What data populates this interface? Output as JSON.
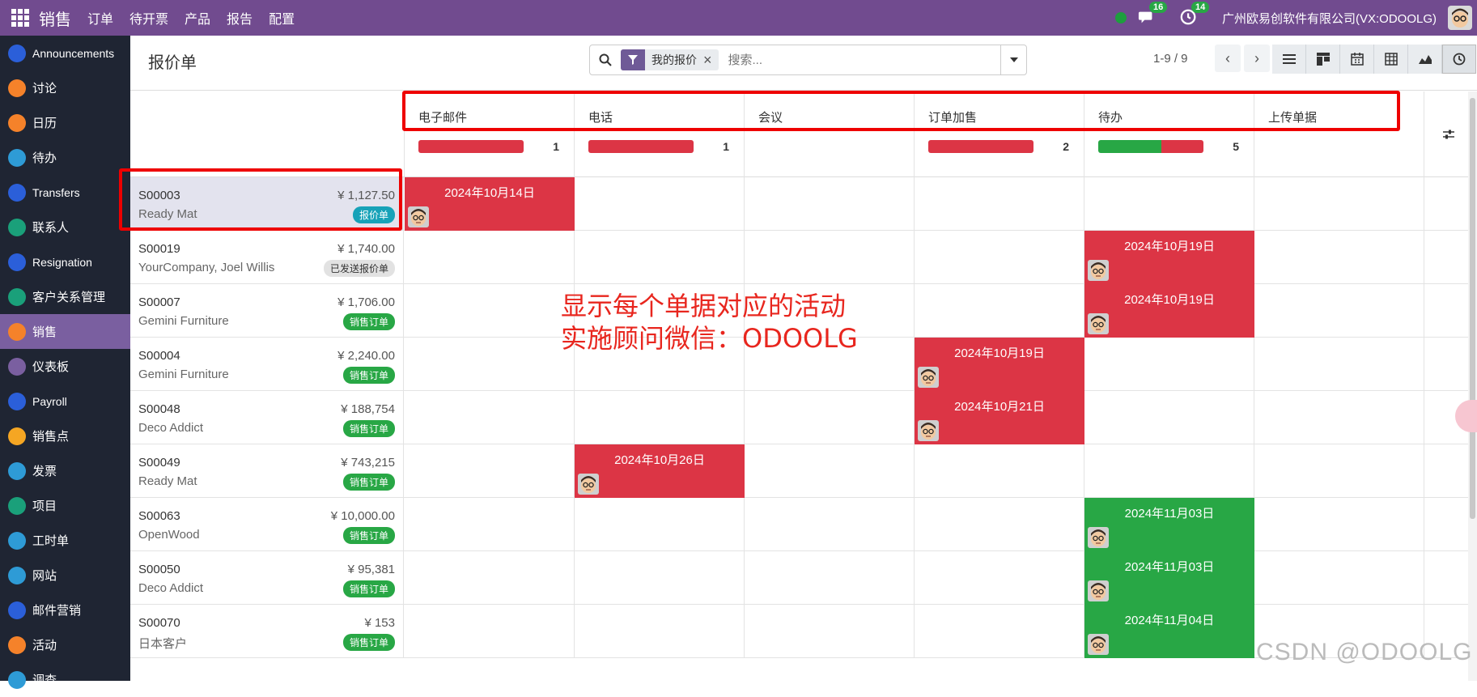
{
  "topbar": {
    "app_name": "销售",
    "menu": [
      "订单",
      "待开票",
      "产品",
      "报告",
      "配置"
    ],
    "messages_count": "16",
    "activities_count": "14",
    "company": "广州欧易创软件有限公司(VX:ODOOLG)"
  },
  "sidebar": {
    "items": [
      {
        "label": "Announcements",
        "icon": "megaphone-icon",
        "color": "#2b5fd9"
      },
      {
        "label": "讨论",
        "icon": "chat-bubble-icon",
        "color": "#f5822a"
      },
      {
        "label": "日历",
        "icon": "calendar-icon",
        "color": "#f5822a"
      },
      {
        "label": "待办",
        "icon": "pen-icon",
        "color": "#2e9bd6"
      },
      {
        "label": "Transfers",
        "icon": "transfer-icon",
        "color": "#2b5fd9"
      },
      {
        "label": "联系人",
        "icon": "contact-card-icon",
        "color": "#1aa07a"
      },
      {
        "label": "Resignation",
        "icon": "resignation-icon",
        "color": "#2b5fd9"
      },
      {
        "label": "客户关系管理",
        "icon": "crm-diamond-icon",
        "color": "#1aa07a"
      },
      {
        "label": "销售",
        "icon": "sales-chart-icon",
        "color": "#f5822a"
      },
      {
        "label": "仪表板",
        "icon": "dashboard-icon",
        "color": "#7a5fa0"
      },
      {
        "label": "Payroll",
        "icon": "payroll-icon",
        "color": "#2b5fd9"
      },
      {
        "label": "销售点",
        "icon": "pos-icon",
        "color": "#f5a623"
      },
      {
        "label": "发票",
        "icon": "invoice-icon",
        "color": "#2e9bd6"
      },
      {
        "label": "项目",
        "icon": "project-check-icon",
        "color": "#1aa07a"
      },
      {
        "label": "工时单",
        "icon": "timesheet-clock-icon",
        "color": "#2e9bd6"
      },
      {
        "label": "网站",
        "icon": "website-globe-icon",
        "color": "#2e9bd6"
      },
      {
        "label": "邮件营销",
        "icon": "email-marketing-icon",
        "color": "#2b5fd9"
      },
      {
        "label": "活动",
        "icon": "event-icon",
        "color": "#f5822a"
      },
      {
        "label": "调查",
        "icon": "survey-icon",
        "color": "#2e9bd6"
      }
    ]
  },
  "control": {
    "title": "报价单",
    "facet": "我的报价",
    "search_placeholder": "搜索...",
    "pager": "1-9 / 9"
  },
  "columns": [
    {
      "title": "电子邮件",
      "count": "1",
      "done_ratio": 0
    },
    {
      "title": "电话",
      "count": "1",
      "done_ratio": 0
    },
    {
      "title": "会议",
      "count": "",
      "done_ratio": null
    },
    {
      "title": "订单加售",
      "count": "2",
      "done_ratio": 0
    },
    {
      "title": "待办",
      "count": "5",
      "done_ratio": 0.6
    },
    {
      "title": "上传单据",
      "count": "",
      "done_ratio": null
    }
  ],
  "rows": [
    {
      "name": "S00003",
      "partner": "Ready Mat",
      "amount": "¥ 1,127.50",
      "status": "报价单",
      "status_type": "quote",
      "activity_col": 0,
      "activity_date": "2024年10月14日",
      "activity_color": "red"
    },
    {
      "name": "S00019",
      "partner": "YourCompany, Joel Willis",
      "amount": "¥ 1,740.00",
      "status": "已发送报价单",
      "status_type": "sent",
      "activity_col": 4,
      "activity_date": "2024年10月19日",
      "activity_color": "red"
    },
    {
      "name": "S00007",
      "partner": "Gemini Furniture",
      "amount": "¥ 1,706.00",
      "status": "销售订单",
      "status_type": "order",
      "activity_col": 4,
      "activity_date": "2024年10月19日",
      "activity_color": "red"
    },
    {
      "name": "S00004",
      "partner": "Gemini Furniture",
      "amount": "¥ 2,240.00",
      "status": "销售订单",
      "status_type": "order",
      "activity_col": 3,
      "activity_date": "2024年10月19日",
      "activity_color": "red"
    },
    {
      "name": "S00048",
      "partner": "Deco Addict",
      "amount": "¥ 188,754",
      "status": "销售订单",
      "status_type": "order",
      "activity_col": 3,
      "activity_date": "2024年10月21日",
      "activity_color": "red"
    },
    {
      "name": "S00049",
      "partner": "Ready Mat",
      "amount": "¥ 743,215",
      "status": "销售订单",
      "status_type": "order",
      "activity_col": 1,
      "activity_date": "2024年10月26日",
      "activity_color": "red"
    },
    {
      "name": "S00063",
      "partner": "OpenWood",
      "amount": "¥ 10,000.00",
      "status": "销售订单",
      "status_type": "order",
      "activity_col": 4,
      "activity_date": "2024年11月03日",
      "activity_color": "green"
    },
    {
      "name": "S00050",
      "partner": "Deco Addict",
      "amount": "¥ 95,381",
      "status": "销售订单",
      "status_type": "order",
      "activity_col": 4,
      "activity_date": "2024年11月03日",
      "activity_color": "green"
    },
    {
      "name": "S00070",
      "partner": "日本客户",
      "amount": "¥ 153",
      "status": "销售订单",
      "status_type": "order",
      "activity_col": 4,
      "activity_date": "2024年11月04日",
      "activity_color": "green"
    }
  ],
  "annotation": {
    "line1": "显示每个单据对应的活动",
    "line2": "实施顾问微信：ODOOLG"
  },
  "watermark": "CSDN @ODOOLG",
  "colors": {
    "topbar": "#714b8f",
    "sidebar": "#1f2533",
    "overdue": "#dc3545",
    "planned": "#28a745",
    "annotation_red": "#e8261e"
  }
}
